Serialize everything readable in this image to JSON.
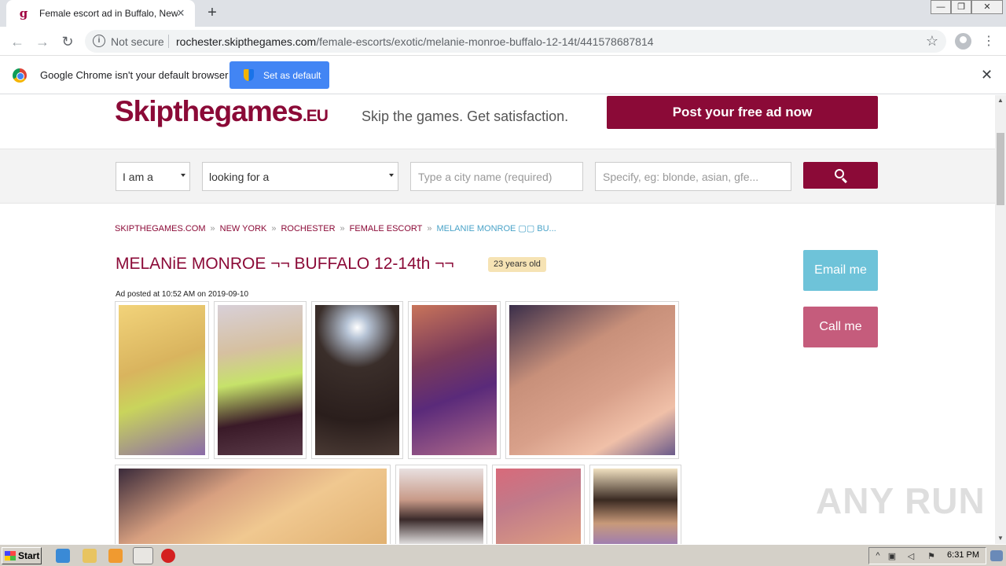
{
  "browser": {
    "tab_title": "Female escort ad in Buffalo, New York",
    "tab_favicon": "g",
    "tab_close": "✕",
    "new_tab": "+",
    "security_label": "Not secure",
    "url_host": "rochester.skipthegames.com",
    "url_path": "/female-escorts/exotic/melanie-monroe-buffalo-12-14t/441578687814",
    "win_minimize": "—",
    "win_restore": "❐",
    "win_close": "✕"
  },
  "infobar": {
    "message": "Google Chrome isn't your default browser",
    "button_label": "Set as default",
    "close": "✕"
  },
  "site": {
    "logo_main": "Skipthegames",
    "logo_suffix": ".EU",
    "tagline": "Skip the games. Get satisfaction.",
    "post_ad_label": "Post your free ad now"
  },
  "search": {
    "i_am_value": "I am a",
    "looking_for_value": "looking for a",
    "city_placeholder": "Type a city name (required)",
    "specify_placeholder": "Specify, eg: blonde, asian, gfe..."
  },
  "breadcrumb": {
    "items": [
      "SKIPTHEGAMES.COM",
      "NEW YORK",
      "ROCHESTER",
      "FEMALE ESCORT"
    ],
    "current": "MELANIE MONROE ▢▢ BU...",
    "separator": "»"
  },
  "ad": {
    "title": "MELANiE MONROE ¬¬ BUFFALO 12-14th ¬¬",
    "age_badge": "23 years old",
    "posted": "Ad posted at 10:52 AM on 2019-09-10"
  },
  "contact": {
    "email_label": "Email me",
    "call_label": "Call me"
  },
  "watermark": "ANY RUN",
  "taskbar": {
    "start_label": "Start",
    "clock": "6:31 PM"
  }
}
